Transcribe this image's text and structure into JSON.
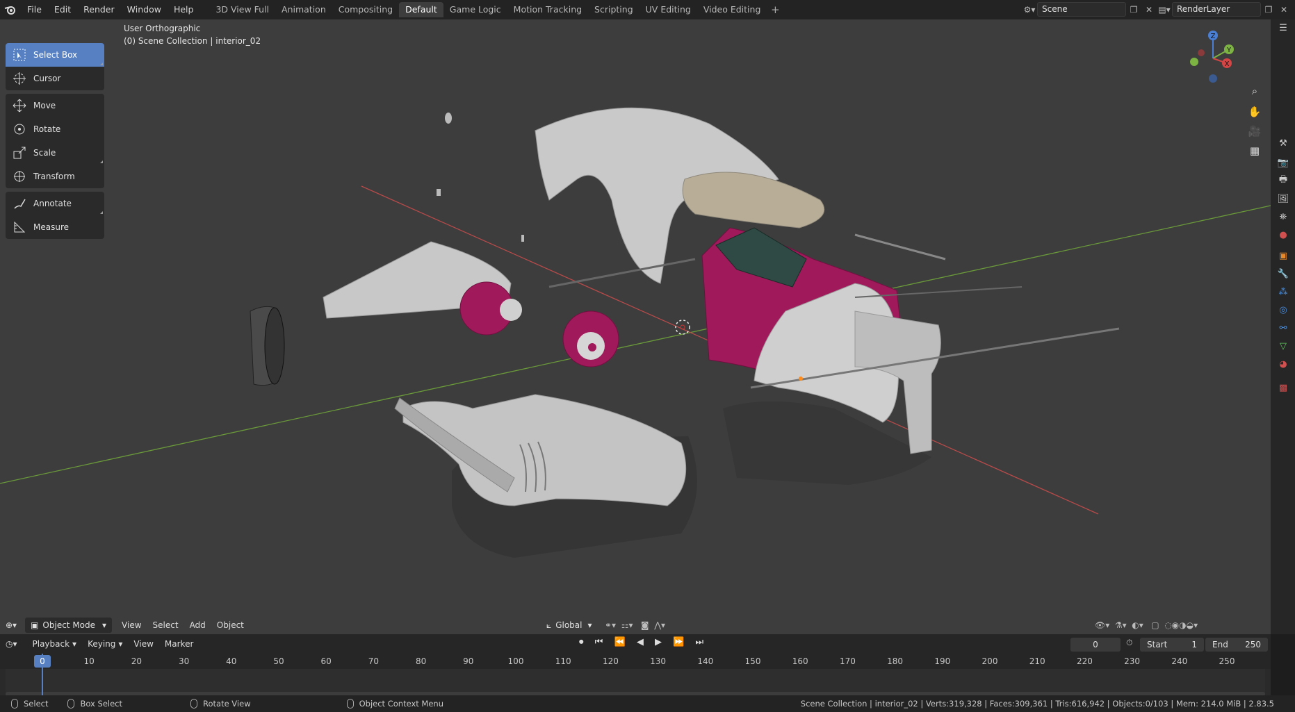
{
  "topbar": {
    "menus": [
      "File",
      "Edit",
      "Render",
      "Window",
      "Help"
    ],
    "workspaces": [
      "3D View Full",
      "Animation",
      "Compositing",
      "Default",
      "Game Logic",
      "Motion Tracking",
      "Scripting",
      "UV Editing",
      "Video Editing"
    ],
    "active_workspace": "Default",
    "scene": "Scene",
    "render_layer": "RenderLayer"
  },
  "viewport": {
    "view_name": "User Orthographic",
    "collection_info": "(0) Scene Collection | interior_02",
    "gizmo_axes": [
      "Z",
      "Y",
      "X"
    ]
  },
  "tools": [
    {
      "label": "Select Box",
      "icon": "select-box-icon",
      "active": true
    },
    {
      "label": "Cursor",
      "icon": "cursor-icon"
    },
    {
      "label": "Move",
      "icon": "move-icon"
    },
    {
      "label": "Rotate",
      "icon": "rotate-icon"
    },
    {
      "label": "Scale",
      "icon": "scale-icon"
    },
    {
      "label": "Transform",
      "icon": "transform-icon"
    },
    {
      "label": "Annotate",
      "icon": "annotate-icon"
    },
    {
      "label": "Measure",
      "icon": "measure-icon"
    }
  ],
  "vp_header": {
    "mode": "Object Mode",
    "menus": [
      "View",
      "Select",
      "Add",
      "Object"
    ],
    "orientation": "Global"
  },
  "timeline": {
    "menus": [
      "Playback",
      "Keying",
      "View",
      "Marker"
    ],
    "current_frame": "0",
    "start_label": "Start",
    "start": "1",
    "end_label": "End",
    "end": "250",
    "ticks": [
      "0",
      "10",
      "20",
      "30",
      "40",
      "50",
      "60",
      "70",
      "80",
      "90",
      "100",
      "110",
      "120",
      "130",
      "140",
      "150",
      "160",
      "170",
      "180",
      "190",
      "200",
      "210",
      "220",
      "230",
      "240",
      "250"
    ]
  },
  "statusbar": {
    "select": "Select",
    "box_select": "Box Select",
    "rotate_view": "Rotate View",
    "context_menu": "Object Context Menu",
    "stats": "Scene Collection | interior_02 | Verts:319,328 | Faces:309,361 | Tris:616,942 | Objects:0/103 | Mem: 214.0 MiB | 2.83.5"
  },
  "colors": {
    "accent": "#5680c2",
    "car_body": "#c2c2c2",
    "interior_magenta": "#a0195a",
    "top_beige": "#b8ae98",
    "grid_red": "#b84a4a",
    "grid_green": "#6a9a3a"
  }
}
